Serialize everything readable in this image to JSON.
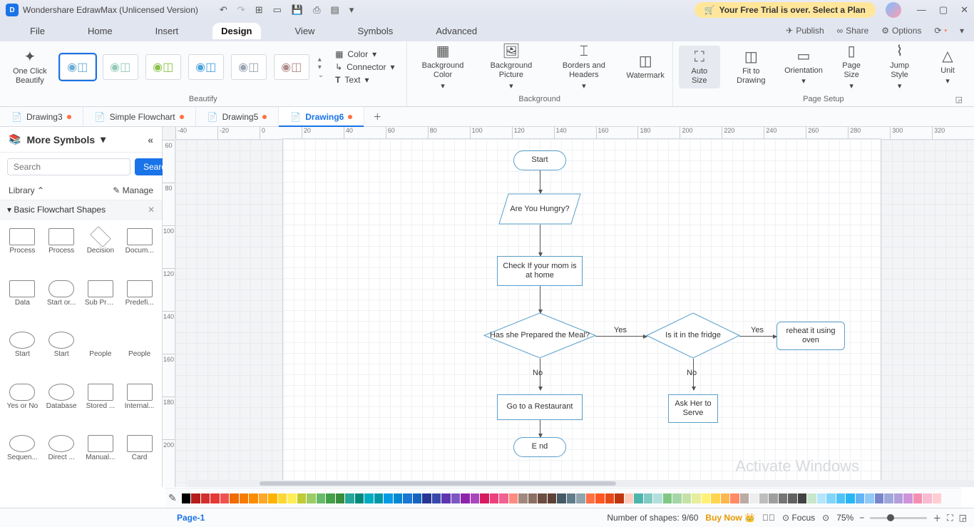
{
  "app": {
    "title": "Wondershare EdrawMax (Unlicensed Version)",
    "trial_notice": "Your Free Trial is over. Select a Plan"
  },
  "menu": {
    "file": "File",
    "home": "Home",
    "insert": "Insert",
    "design": "Design",
    "view": "View",
    "symbols": "Symbols",
    "advanced": "Advanced",
    "publish": "Publish",
    "share": "Share",
    "options": "Options"
  },
  "ribbon": {
    "beautify_btn": "One Click\nBeautify",
    "color": "Color",
    "connector": "Connector",
    "text": "Text",
    "bg_color": "Background Color",
    "bg_picture": "Background Picture",
    "borders": "Borders and Headers",
    "watermark": "Watermark",
    "auto_size": "Auto Size",
    "fit": "Fit to Drawing",
    "orientation": "Orientation",
    "page_size": "Page Size",
    "jump_style": "Jump Style",
    "unit": "Unit",
    "group_beautify": "Beautify",
    "group_bg": "Background",
    "group_pagesetup": "Page Setup"
  },
  "tabs": {
    "t1": "Drawing3",
    "t2": "Simple Flowchart",
    "t3": "Drawing5",
    "t4": "Drawing6"
  },
  "sidebar": {
    "more": "More Symbols",
    "search_placeholder": "Search",
    "search_btn": "Search",
    "library": "Library",
    "manage": "Manage",
    "panel_title": "Basic Flowchart Shapes",
    "shapes": [
      "Process",
      "Process",
      "Decision",
      "Docum...",
      "Data",
      "Start or...",
      "Sub Pro...",
      "Predefi...",
      "Start",
      "Start",
      "People",
      "People",
      "Yes or No",
      "Database",
      "Stored ...",
      "Internal...",
      "Sequen...",
      "Direct ...",
      "Manual...",
      "Card"
    ]
  },
  "canvas": {
    "start": "Start",
    "hungry": "Are You Hungry?",
    "check": "Check If your mom is at home",
    "prepared": "Has she Prepared the Meal?",
    "fridge": "Is it in the fridge",
    "reheat": "reheat it using oven",
    "restaurant": "Go to a Restaurant",
    "ask": "Ask Her to Serve",
    "end": "E nd",
    "yes": "Yes",
    "no": "No",
    "watermark": "Activate Windows"
  },
  "status": {
    "page_label": "Page-1",
    "page_tab": "Page-1",
    "shapes_count": "Number of shapes: 9/60",
    "buy": "Buy Now",
    "focus": "Focus",
    "zoom": "75%"
  },
  "ruler_h": [
    "-40",
    "-20",
    "0",
    "20",
    "40",
    "60",
    "80",
    "100",
    "120",
    "140",
    "160",
    "180",
    "200",
    "220",
    "240",
    "260",
    "280",
    "300",
    "320"
  ],
  "ruler_v": [
    "60",
    "80",
    "100",
    "120",
    "140",
    "160",
    "180",
    "200"
  ],
  "chart_data": {
    "type": "flowchart",
    "nodes": [
      {
        "id": "start",
        "shape": "terminator",
        "label": "Start"
      },
      {
        "id": "hungry",
        "shape": "data",
        "label": "Are You Hungry?"
      },
      {
        "id": "check",
        "shape": "process",
        "label": "Check If your mom is at home"
      },
      {
        "id": "prepared",
        "shape": "decision",
        "label": "Has she Prepared the Meal?"
      },
      {
        "id": "fridge",
        "shape": "decision",
        "label": "Is it in the fridge"
      },
      {
        "id": "reheat",
        "shape": "process",
        "label": "reheat it using oven"
      },
      {
        "id": "restaurant",
        "shape": "process",
        "label": "Go to a Restaurant"
      },
      {
        "id": "ask",
        "shape": "process",
        "label": "Ask Her to Serve"
      },
      {
        "id": "end",
        "shape": "terminator",
        "label": "End"
      }
    ],
    "edges": [
      {
        "from": "start",
        "to": "hungry"
      },
      {
        "from": "hungry",
        "to": "check"
      },
      {
        "from": "check",
        "to": "prepared"
      },
      {
        "from": "prepared",
        "to": "fridge",
        "label": "Yes"
      },
      {
        "from": "prepared",
        "to": "restaurant",
        "label": "No"
      },
      {
        "from": "fridge",
        "to": "reheat",
        "label": "Yes"
      },
      {
        "from": "fridge",
        "to": "ask",
        "label": "No"
      },
      {
        "from": "restaurant",
        "to": "end"
      }
    ]
  },
  "palette": [
    "#000000",
    "#b71c1c",
    "#d32f2f",
    "#e53935",
    "#ef5350",
    "#ef6c00",
    "#f57c00",
    "#fb8c00",
    "#ffa726",
    "#ffb300",
    "#fdd835",
    "#ffee58",
    "#c0ca33",
    "#9ccc65",
    "#66bb6a",
    "#43a047",
    "#388e3c",
    "#26a69a",
    "#00897b",
    "#00acc1",
    "#0097a7",
    "#039be5",
    "#0288d1",
    "#1976d2",
    "#1565c0",
    "#283593",
    "#3949ab",
    "#5e35b1",
    "#7e57c2",
    "#8e24aa",
    "#ab47bc",
    "#d81b60",
    "#ec407a",
    "#f06292",
    "#ff8a80",
    "#a1887f",
    "#8d6e63",
    "#6d4c41",
    "#5d4037",
    "#455a64",
    "#607d8b",
    "#90a4ae",
    "#ff7043",
    "#ff5722",
    "#e64a19",
    "#bf360c",
    "#ffccbc",
    "#4db6ac",
    "#80cbc4",
    "#b2dfdb",
    "#81c784",
    "#a5d6a7",
    "#c5e1a5",
    "#e6ee9c",
    "#fff176",
    "#ffd54f",
    "#ffb74d",
    "#ff8a65",
    "#bcaaa4",
    "#eeeeee",
    "#bdbdbd",
    "#9e9e9e",
    "#757575",
    "#616161",
    "#424242",
    "#c8e6c9",
    "#b3e5fc",
    "#81d4fa",
    "#4fc3f7",
    "#29b6f6",
    "#64b5f6",
    "#90caf9",
    "#7986cb",
    "#9fa8da",
    "#b39ddb",
    "#ce93d8",
    "#f48fb1",
    "#f8bbd0",
    "#ffcdd2"
  ]
}
